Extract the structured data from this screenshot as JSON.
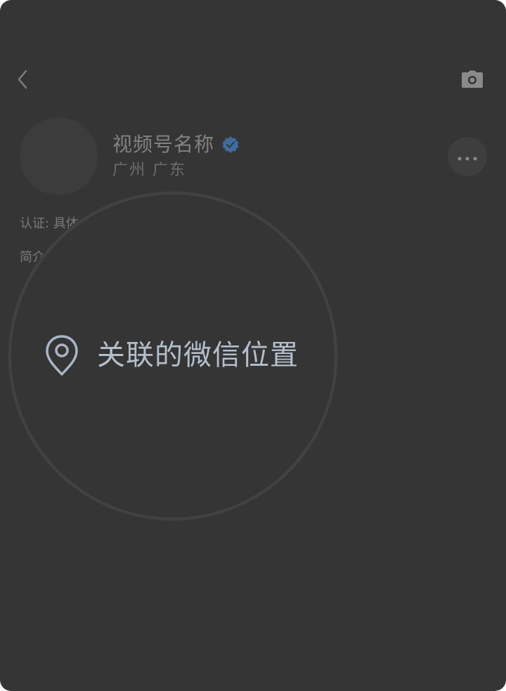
{
  "profile": {
    "name": "视频号名称",
    "location": "广州 广东"
  },
  "info": {
    "certification": "认证: 具体",
    "bio": "简介"
  },
  "zoom": {
    "label": "关联的微信位置"
  },
  "icons": {
    "back": "chevron-left-icon",
    "camera": "camera-icon",
    "verified": "verified-badge-icon",
    "more": "more-dots-icon",
    "location": "location-pin-icon"
  },
  "colors": {
    "background": "#353535",
    "verified": "#3f6d9c",
    "zoom_text": "#b4bfcd"
  }
}
